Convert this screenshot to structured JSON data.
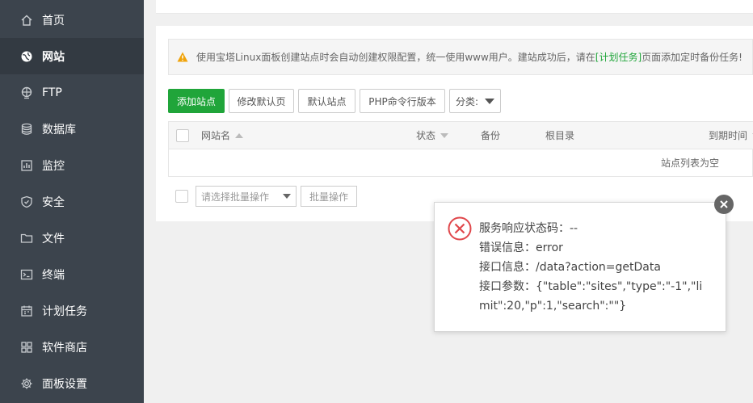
{
  "sidebar": {
    "items": [
      {
        "label": "首页",
        "icon": "home-icon"
      },
      {
        "label": "网站",
        "icon": "globe-icon",
        "active": true
      },
      {
        "label": "FTP",
        "icon": "ftp-icon"
      },
      {
        "label": "数据库",
        "icon": "database-icon"
      },
      {
        "label": "监控",
        "icon": "monitor-icon"
      },
      {
        "label": "安全",
        "icon": "shield-icon"
      },
      {
        "label": "文件",
        "icon": "folder-icon"
      },
      {
        "label": "终端",
        "icon": "terminal-icon"
      },
      {
        "label": "计划任务",
        "icon": "calendar-icon"
      },
      {
        "label": "软件商店",
        "icon": "apps-icon"
      },
      {
        "label": "面板设置",
        "icon": "gear-icon"
      }
    ]
  },
  "tip": {
    "before": "使用宝塔Linux面板创建站点时会自动创建权限配置，统一使用www用户。建站成功后，请在",
    "link": "[计划任务]",
    "after": "页面添加定时备份任务!"
  },
  "toolbar": {
    "add_site": "添加站点",
    "edit_default_page": "修改默认页",
    "default_site": "默认站点",
    "php_cli_version": "PHP命令行版本",
    "category": "分类:"
  },
  "table": {
    "headers": {
      "site_name": "网站名",
      "status": "状态",
      "backup": "备份",
      "root_dir": "根目录",
      "expire_time": "到期时间"
    },
    "empty_text": "站点列表为空"
  },
  "bulk": {
    "select_placeholder": "请选择批量操作",
    "button": "批量操作"
  },
  "dialog": {
    "lines": [
      "服务响应状态码：--",
      "错误信息：error",
      "接口信息：/data?action=getData",
      "接口参数：{\"table\":\"sites\",\"type\":\"-1\",\"limit\":20,\"p\":1,\"search\":\"\"}"
    ]
  },
  "colors": {
    "sidebar_bg": "#3c444d",
    "accent_green": "#20a53a",
    "error_red": "#e0474b",
    "warning_orange": "#f0a30a"
  }
}
